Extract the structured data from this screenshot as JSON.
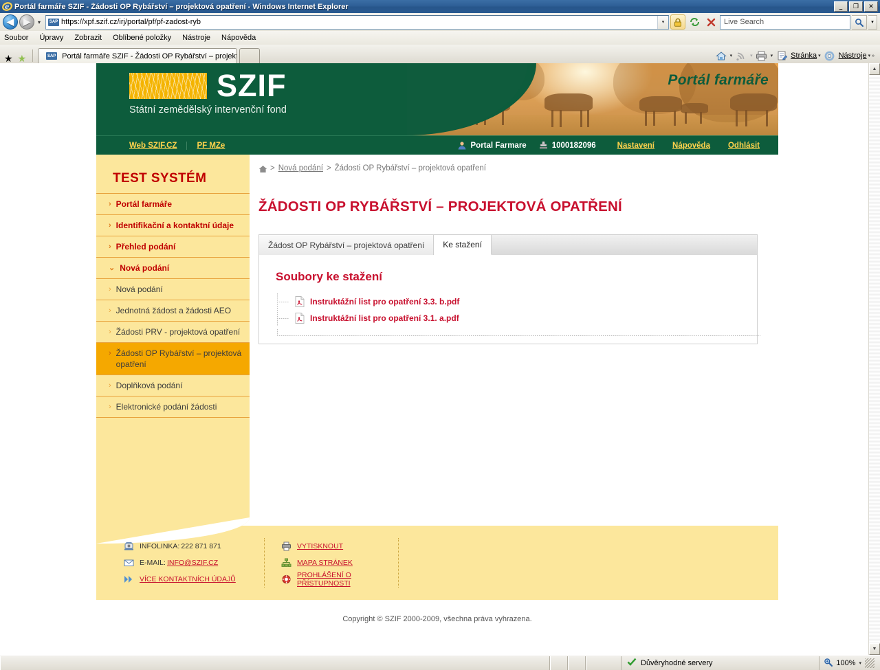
{
  "browser": {
    "window_title": "Portál farmáře SZIF - Žádosti OP Rybářství – projektová opatření - Windows Internet Explorer",
    "minimize_label": "_",
    "maximize_label": "❐",
    "close_label": "✕",
    "back_label": "◀",
    "forward_label": "▶",
    "address_value": "https://xpf.szif.cz/irj/portal/pf/pf-zadost-ryb",
    "address_badge": "SAP",
    "search_placeholder": "Live Search",
    "menu": [
      "Soubor",
      "Úpravy",
      "Zobrazit",
      "Oblíbené položky",
      "Nástroje",
      "Nápověda"
    ],
    "tab_title": "Portál farmáře SZIF - Žádosti OP Rybářství – projekto…",
    "toolbar_right": [
      "Stránka",
      "Nástroje"
    ],
    "toolbar_overflow": "»"
  },
  "status": {
    "zone_text": "Důvěryhodné servery",
    "zoom_level": "100%"
  },
  "site_header": {
    "logo_name": "SZIF",
    "logo_subtitle": "Státní zemědělský intervenční fond",
    "portal_label": "Portál farmáře",
    "nav_left": [
      "Web SZIF.CZ",
      "PF MZe"
    ],
    "user_name": "Portal Farmare",
    "user_id": "1000182096",
    "nav_right": [
      "Nastavení",
      "Nápověda",
      "Odhlásit"
    ]
  },
  "sidebar": {
    "title": "TEST SYSTÉM",
    "items": [
      {
        "label": "Portál farmáře",
        "level": "top",
        "chev": "›",
        "active": false
      },
      {
        "label": "Identifikační a kontaktní údaje",
        "level": "top",
        "chev": "›",
        "active": false
      },
      {
        "label": "Přehled podání",
        "level": "top",
        "chev": "›",
        "active": false
      },
      {
        "label": "Nová podání",
        "level": "top",
        "chev": "⌄",
        "active": false
      },
      {
        "label": "Nová podání",
        "level": "sub",
        "chev": "›",
        "active": false
      },
      {
        "label": "Jednotná žádost a žádosti AEO",
        "level": "sub",
        "chev": "›",
        "active": false
      },
      {
        "label": "Žádosti PRV - projektová opatření",
        "level": "sub",
        "chev": "›",
        "active": false
      },
      {
        "label": "Žádosti OP Rybářství – projektová opatření",
        "level": "sub",
        "chev": "›",
        "active": true
      },
      {
        "label": "Doplňková podání",
        "level": "sub",
        "chev": "›",
        "active": false
      },
      {
        "label": "Elektronické podání žádosti",
        "level": "sub",
        "chev": "›",
        "active": false
      }
    ]
  },
  "main": {
    "breadcrumb": {
      "home_icon": "home-icon",
      "sep": ">",
      "link": "Nová podání",
      "current": "Žádosti OP Rybářství – projektová opatření"
    },
    "page_title": "ŽÁDOSTI OP RYBÁŘSTVÍ – PROJEKTOVÁ OPATŘENÍ",
    "tabs": [
      {
        "label": "Žádost OP Rybářství – projektová opatření",
        "active": false
      },
      {
        "label": "Ke stažení",
        "active": true
      }
    ],
    "section_title": "Soubory ke stažení",
    "files": [
      {
        "name": "Instruktážní list pro opatření 3.3. b.pdf",
        "icon": "pdf-icon"
      },
      {
        "name": "Instruktážní list pro opatření 3.1. a.pdf",
        "icon": "pdf-icon"
      }
    ]
  },
  "footer": {
    "col1": [
      {
        "icon": "phone-icon",
        "prefix": "INFOLINKA: ",
        "text": "222 871 871",
        "link": false
      },
      {
        "icon": "mail-icon",
        "prefix": "E-MAIL: ",
        "text": "INFO@SZIF.CZ",
        "link": true
      },
      {
        "icon": "double-arrow-icon",
        "prefix": "",
        "text": "VÍCE KONTAKTNÍCH ÚDAJŮ",
        "link": true
      }
    ],
    "col2": [
      {
        "icon": "printer-icon",
        "prefix": "",
        "text": "VYTISKNOUT",
        "link": true
      },
      {
        "icon": "sitemap-icon",
        "prefix": "",
        "text": "MAPA STRÁNEK",
        "link": true
      },
      {
        "icon": "lifebuoy-icon",
        "prefix": "",
        "text": "PROHLÁŠENÍ O PŘÍSTUPNOSTI",
        "link": true
      }
    ],
    "copyright": "Copyright © SZIF 2000-2009, všechna práva vyhrazena."
  },
  "colors": {
    "brand_green": "#0d5c3c",
    "brand_yellow": "#fce79c",
    "accent_orange": "#f5a800",
    "accent_red": "#c8102e",
    "link_yellow": "#ffd34d"
  }
}
